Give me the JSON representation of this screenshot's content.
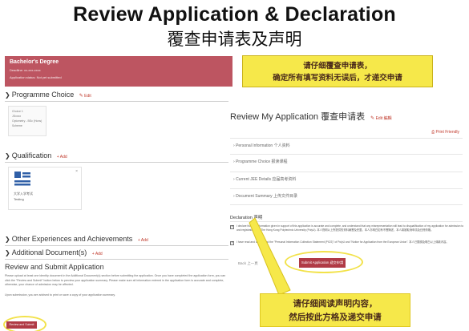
{
  "slide": {
    "title_en": "Review Application & Declaration",
    "title_zh": "覆查申请表及声明"
  },
  "left_panel": {
    "banner": {
      "degree": "Bachelor's Degree",
      "deadline": "Deadline: xx-xxx-xxxx",
      "status": "Application status: Not yet submitted"
    },
    "programme_choice": {
      "heading": "Programme Choice",
      "edit_label": "Edit",
      "card_lines": [
        "Choice 1",
        "JSxxxx",
        "Optometry - BSc (Hons)",
        "Scheme"
      ]
    },
    "qualification": {
      "heading": "Qualification",
      "add_label": "Add",
      "card_name": "大学入学考试",
      "card_sub": "Testing",
      "close": "×"
    },
    "other_experiences": {
      "heading": "Other Experiences and Achievements",
      "add_label": "Add"
    },
    "additional_documents": {
      "heading": "Additional Document(s)",
      "add_label": "Add"
    },
    "review_submit": {
      "heading": "Review and Submit Application",
      "text": "Please upload at least one identity document in the Additional Document(s) section before submitting the application. Once you have completed the application form, you can click the \"Review and Submit\" button below to preview your application summary. Please make sure all information entered in the application form is accurate and complete, otherwise, your chance of admission may be affected.",
      "text2": "Upon submission, you are advised to print or save a copy of your application summary.",
      "button_label": "Review and Submit"
    }
  },
  "right_panel": {
    "title": "Review My Application 覆查申请表",
    "edit_label": "Edit 編輯",
    "print_label": "Print Friendly",
    "items": [
      "Personal Information 个人资料",
      "Programme Choice 报读课程",
      "Current JEE Details 应届高考资料",
      "Document Summary 上传文件目录"
    ],
    "declaration_title": "Declaration 声明",
    "decl_1": "I declare that the information given in support of this application is accurate and complete, and understand that any misrepresentation will lead to disqualification of my application for admission to and registration with The Hong Kong Polytechnic University (PolyU). 本人聲明以上所提供的資料屬實及完整。本人亦明白如有不實陳述，本人將被取消申請及註冊資格。",
    "decl_2": "I have read and understood the \"Personal Information Collection Statement (PICS)\" of PolyU and \"Notice for Application from the European Union\". 本人已閱讀及明白以上條款內容。",
    "back_label": "Back 上一頁",
    "submit_label": "Submit Application 遞交申請"
  },
  "callouts": {
    "top_line1": "请仔细覆查申请表，",
    "top_line2": "确定所有填写资料无误后，才递交申请",
    "bottom_line1": "请仔细阅读声明内容，",
    "bottom_line2": "然后按此方格及递交申请"
  }
}
